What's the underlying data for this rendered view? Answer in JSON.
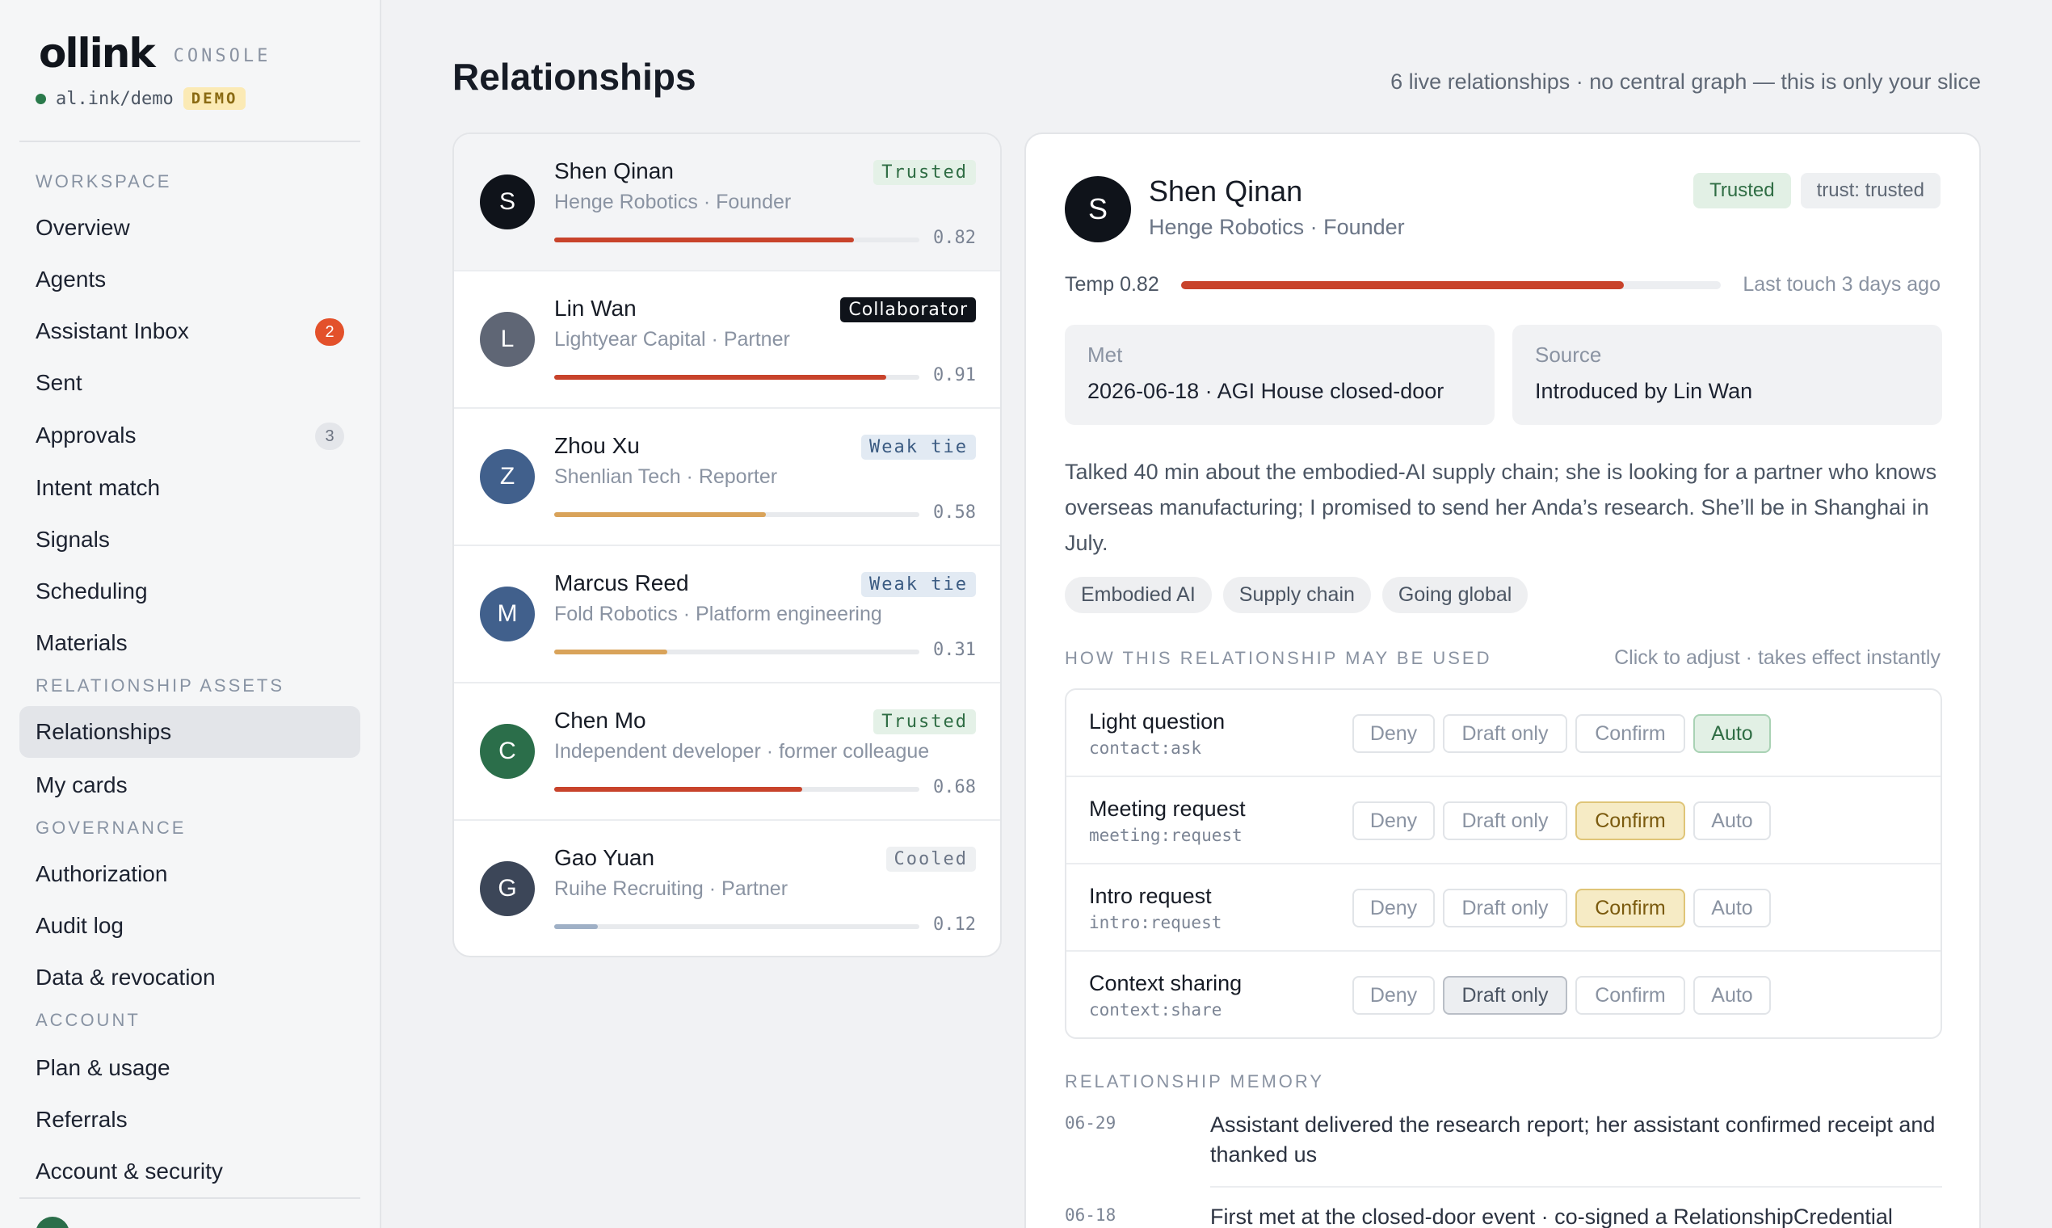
{
  "brand": {
    "logo": "ollink",
    "console": "CONSOLE",
    "tenant": "al.ink/demo",
    "tenant_badge": "DEMO"
  },
  "sidebar": {
    "sections": {
      "workspace": "WORKSPACE",
      "assets": "RELATIONSHIP ASSETS",
      "governance": "GOVERNANCE",
      "account": "ACCOUNT"
    },
    "items": [
      {
        "label": "Overview"
      },
      {
        "label": "Agents"
      },
      {
        "label": "Assistant Inbox",
        "count": "2"
      },
      {
        "label": "Sent"
      },
      {
        "label": "Approvals",
        "count": "3"
      },
      {
        "label": "Intent match"
      },
      {
        "label": "Signals"
      },
      {
        "label": "Scheduling"
      },
      {
        "label": "Materials"
      },
      {
        "label": "Relationships"
      },
      {
        "label": "My cards"
      },
      {
        "label": "Authorization"
      },
      {
        "label": "Audit log"
      },
      {
        "label": "Data & revocation"
      },
      {
        "label": "Plan & usage"
      },
      {
        "label": "Referrals"
      },
      {
        "label": "Account & security"
      }
    ]
  },
  "header": {
    "title": "Relationships",
    "summary": "6 live relationships · no central graph — this is only your slice"
  },
  "relationships": [
    {
      "initial": "S",
      "name": "Shen Qinan",
      "subtitle": "Henge Robotics · Founder",
      "badge": "Trusted",
      "temp": 0.82,
      "temp_label": "0.82",
      "avatar_color": "#0f131a",
      "bar_color": "#c8432b"
    },
    {
      "initial": "L",
      "name": "Lin Wan",
      "subtitle": "Lightyear Capital · Partner",
      "badge": "Collaborator",
      "temp": 0.91,
      "temp_label": "0.91",
      "avatar_color": "#5f6675",
      "bar_color": "#c8432b"
    },
    {
      "initial": "Z",
      "name": "Zhou Xu",
      "subtitle": "Shenlian Tech · Reporter",
      "badge": "Weak tie",
      "temp": 0.58,
      "temp_label": "0.58",
      "avatar_color": "#41608c",
      "bar_color": "#d9a35a"
    },
    {
      "initial": "M",
      "name": "Marcus Reed",
      "subtitle": "Fold Robotics · Platform engineering",
      "badge": "Weak tie",
      "temp": 0.31,
      "temp_label": "0.31",
      "avatar_color": "#41608c",
      "bar_color": "#d9a35a"
    },
    {
      "initial": "C",
      "name": "Chen Mo",
      "subtitle": "Independent developer · former colleague",
      "badge": "Trusted",
      "temp": 0.68,
      "temp_label": "0.68",
      "avatar_color": "#2b6e4a",
      "bar_color": "#c8432b"
    },
    {
      "initial": "G",
      "name": "Gao Yuan",
      "subtitle": "Ruihe Recruiting · Partner",
      "badge": "Cooled",
      "temp": 0.12,
      "temp_label": "0.12",
      "avatar_color": "#3c4658",
      "bar_color": "#9fb0c6"
    }
  ],
  "detail": {
    "initial": "S",
    "name": "Shen Qinan",
    "subtitle": "Henge Robotics · Founder",
    "tag_trust": "Trusted",
    "tag_level": "trust: trusted",
    "temp_label": "Temp 0.82",
    "temp": 0.82,
    "last_touch": "Last touch 3 days ago",
    "met_label": "Met",
    "met_value": "2026-06-18 · AGI House closed-door",
    "source_label": "Source",
    "source_value": "Introduced by Lin Wan",
    "notes": "Talked 40 min about the embodied-AI supply chain; she is looking for a partner who knows overseas manufacturing; I promised to send her Anda’s research. She’ll be in Shanghai in July.",
    "chips": [
      "Embodied AI",
      "Supply chain",
      "Going global"
    ]
  },
  "permissions": {
    "heading": "HOW THIS RELATIONSHIP MAY BE USED",
    "hint": "Click to adjust · takes effect instantly",
    "options": [
      "Deny",
      "Draft only",
      "Confirm",
      "Auto"
    ],
    "rows": [
      {
        "label": "Light question",
        "scope": "contact:ask",
        "selected": "Auto"
      },
      {
        "label": "Meeting request",
        "scope": "meeting:request",
        "selected": "Confirm"
      },
      {
        "label": "Intro request",
        "scope": "intro:request",
        "selected": "Confirm"
      },
      {
        "label": "Context sharing",
        "scope": "context:share",
        "selected": "Draft only"
      }
    ]
  },
  "memory": {
    "heading": "RELATIONSHIP MEMORY",
    "entries": [
      {
        "date": "06-29",
        "text": "Assistant delivered the research report; her assistant confirmed receipt and thanked us"
      },
      {
        "date": "06-18",
        "text": "First met at the closed-door event · co-signed a RelationshipCredential"
      }
    ]
  },
  "colors": {
    "accent_red": "#c8432b",
    "warm": "#d9a35a",
    "trusted_green": "#2f6d44",
    "confirm_amber": "#7a5a0e"
  }
}
